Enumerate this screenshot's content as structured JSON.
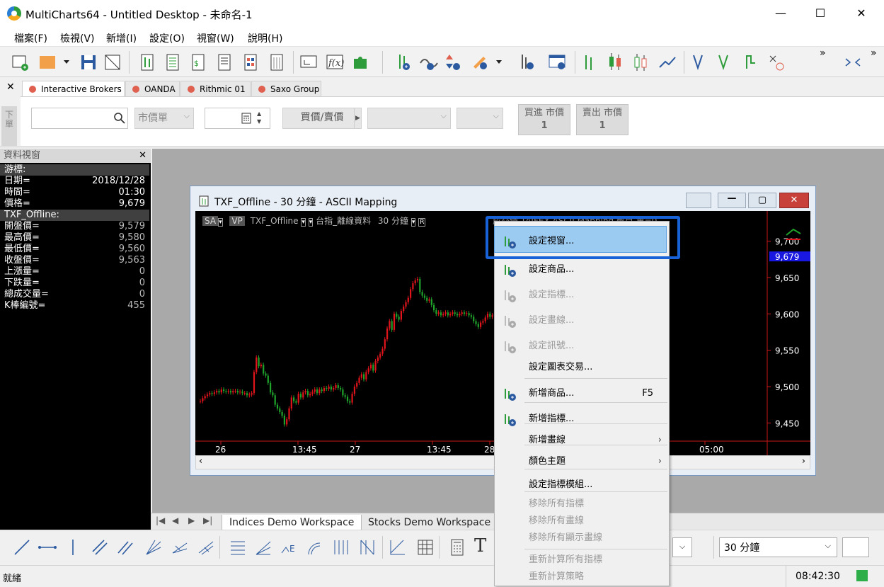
{
  "window": {
    "title": "MultiCharts64 - Untitled Desktop - 未命名-1",
    "minimize": "—",
    "maximize": "☐",
    "close": "✕"
  },
  "menu": [
    "檔案(F)",
    "檢視(V)",
    "新增(I)",
    "設定(O)",
    "視窗(W)",
    "說明(H)"
  ],
  "toolbar": {
    "overflow1": "»",
    "overflow2": "»"
  },
  "broker_tabs": [
    "Interactive Brokers",
    "OANDA",
    "Rithmic 01",
    "Saxo Group"
  ],
  "order": {
    "symbol_placeholder": "",
    "order_type": "市價單",
    "quantity": "",
    "buy_sell": "買價/賣價",
    "buy_market_label": "買進 市價",
    "buy_market_qty": "1",
    "sell_market_label": "賣出 市價",
    "sell_market_qty": "1",
    "side_label": "下單"
  },
  "data_window": {
    "title": "資料視窗",
    "cursor_header": "游標:",
    "cursor_rows": [
      {
        "k": "日期=",
        "v": "2018/12/28"
      },
      {
        "k": "時間=",
        "v": "01:30"
      },
      {
        "k": "價格=",
        "v": "9,679"
      }
    ],
    "symbol_header": "TXF_Offline:",
    "symbol_rows": [
      {
        "k": "開盤價=",
        "v": "9,579"
      },
      {
        "k": "最高價=",
        "v": "9,580"
      },
      {
        "k": "最低價=",
        "v": "9,560"
      },
      {
        "k": "收盤價=",
        "v": "9,563"
      },
      {
        "k": "上漲量=",
        "v": "0"
      },
      {
        "k": "下跌量=",
        "v": "0"
      },
      {
        "k": "總成交量=",
        "v": "0"
      },
      {
        "k": "K棒編號=",
        "v": "455"
      }
    ]
  },
  "chart_window": {
    "title": "TXF_Offline - 30 分鐘 - ASCII Mapping",
    "status_sa": "SA",
    "status_vp": "VP",
    "status_symbol": "TXF_Offline",
    "status_desc": "台指_離線資料",
    "status_interval": "30 分鐘",
    "status_tail": "成交價   TAIFEX  ASCII Mapping  數目  單=0",
    "price_ticks": [
      "9,700",
      "9,650",
      "9,600",
      "9,550",
      "9,500",
      "9,450"
    ],
    "current_price": "9,679",
    "time_ticks": [
      "26",
      "13:45",
      "27",
      "13:45",
      "28",
      "05:00"
    ]
  },
  "chart_data": {
    "type": "candlestick",
    "symbol": "TXF_Offline",
    "interval": "30 分鐘",
    "ylim": [
      9425,
      9720
    ],
    "closes": [
      9480,
      9484,
      9487,
      9489,
      9491,
      9490,
      9492,
      9494,
      9492,
      9496,
      9494,
      9493,
      9494,
      9492,
      9494,
      9494,
      9492,
      9493,
      9491,
      9491,
      9488,
      9489,
      9491,
      9520,
      9540,
      9528,
      9530,
      9518,
      9515,
      9505,
      9492,
      9488,
      9475,
      9470,
      9465,
      9460,
      9448,
      9455,
      9470,
      9485,
      9480,
      9478,
      9490,
      9485,
      9492,
      9494,
      9488,
      9490,
      9493,
      9496,
      9491,
      9496,
      9494,
      9498,
      9497,
      9500,
      9496,
      9498,
      9502,
      9498,
      9496,
      9488,
      9486,
      9480,
      9478,
      9490,
      9500,
      9505,
      9512,
      9517,
      9510,
      9520,
      9525,
      9530,
      9522,
      9535,
      9540,
      9545,
      9552,
      9565,
      9580,
      9590,
      9578,
      9600,
      9596,
      9592,
      9604,
      9610,
      9616,
      9622,
      9634,
      9642,
      9646,
      9648,
      9630,
      9625,
      9622,
      9618,
      9620,
      9612,
      9605,
      9600,
      9602,
      9598,
      9600,
      9602,
      9598,
      9600,
      9602,
      9600,
      9598,
      9600,
      9602,
      9600,
      9601,
      9598,
      9596,
      9590,
      9586,
      9582,
      9588,
      9590,
      9595,
      9600,
      9596,
      9598,
      9600
    ]
  },
  "context_menu": {
    "items": [
      {
        "label": "設定視窗...",
        "disabled": false,
        "icon": "format-window-icon"
      },
      {
        "label": "設定商品...",
        "disabled": false,
        "icon": "format-symbol-icon"
      },
      {
        "label": "設定指標...",
        "disabled": true,
        "icon": "format-indicator-icon"
      },
      {
        "label": "設定畫線...",
        "disabled": true,
        "icon": "format-drawing-icon"
      },
      {
        "label": "設定訊號...",
        "disabled": true,
        "icon": "format-signal-icon"
      },
      {
        "label": "設定圖表交易...",
        "disabled": false,
        "icon": ""
      },
      {
        "label": "新增商品...",
        "shortcut": "F5",
        "disabled": false,
        "icon": "insert-symbol-icon"
      },
      {
        "label": "新增指標...",
        "disabled": false,
        "icon": "insert-indicator-icon"
      },
      {
        "label": "新增畫線",
        "submenu": "›",
        "disabled": false,
        "icon": ""
      },
      {
        "label": "顏色主題",
        "submenu": "›",
        "disabled": false,
        "icon": ""
      },
      {
        "label": "設定指標模組...",
        "disabled": false,
        "icon": ""
      },
      {
        "label": "移除所有指標",
        "disabled": true,
        "icon": ""
      },
      {
        "label": "移除所有畫線",
        "disabled": true,
        "icon": ""
      },
      {
        "label": "移除所有顯示畫線",
        "disabled": true,
        "icon": ""
      },
      {
        "label": "重新計算所有指標",
        "disabled": true,
        "icon": ""
      },
      {
        "label": "重新計算策略",
        "disabled": true,
        "icon": ""
      }
    ]
  },
  "workspace_tabs": [
    "Indices Demo Workspace",
    "Stocks Demo Workspace"
  ],
  "drawbar": {
    "interval": "30 分鐘",
    "text_tool": "T"
  },
  "status": {
    "text": "就緒",
    "time": "08:42:30"
  },
  "colors": {
    "up": "#e0141b",
    "down": "#1fa32b",
    "highlight": "#1862d8",
    "chart_bg": "#000000"
  }
}
